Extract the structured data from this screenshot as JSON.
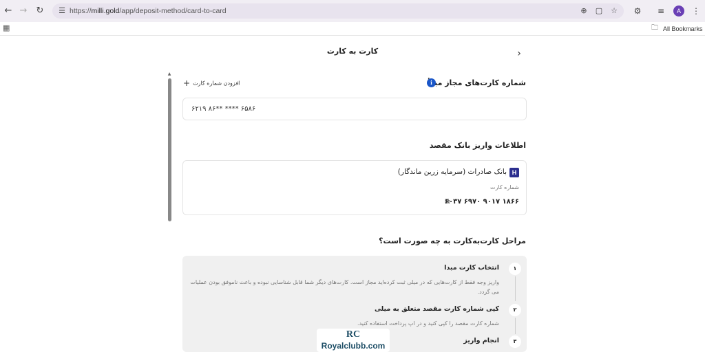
{
  "browser": {
    "url_prefix": "https://",
    "url_host": "milli.gold",
    "url_path": "/app/deposit-method/card-to-card",
    "avatar_letter": "A",
    "bookmarks_label": "All Bookmarks"
  },
  "page": {
    "title": "کارت به کارت"
  },
  "source_cards": {
    "heading": "شماره کارت‌های مجاز مبدأ",
    "add_label": "افزودن شماره کارت",
    "masked_number": "۶۲۱۹ ۸۶** **** ۶۵۸۶"
  },
  "destination": {
    "heading": "اطلاعات واریز بانک مقصد",
    "bank_name": "بانک صادرات",
    "owner": "(سرمایه زرین ماندگار)",
    "card_label": "شماره کارت",
    "card_number": "۶۰۳۷ ۶۹۷۰ ۹۰۱۷ ۱۸۶۶"
  },
  "steps": {
    "heading": "مراحل کارت‌به‌کارت به چه صورت است؟",
    "items": [
      {
        "number": "۱",
        "title": "انتخاب کارت مبدا",
        "desc": "واریز وجه فقط از کارت‌هایی که در میلی ثبت کرده‌اید مجاز است. کارت‌های دیگر شما قابل شناسایی نبوده و باعث ناموفق بودن عملیات می گردد."
      },
      {
        "number": "۲",
        "title": "کپی شماره کارت مقصد متعلق به میلی",
        "desc": "شماره کارت مقصد را کپی کنید و در اپ پرداخت استفاده کنید."
      },
      {
        "number": "۳",
        "title": "انجام واریز",
        "desc": ""
      }
    ]
  },
  "watermark": {
    "logo": "RC",
    "text": "Royalclubb.com"
  }
}
